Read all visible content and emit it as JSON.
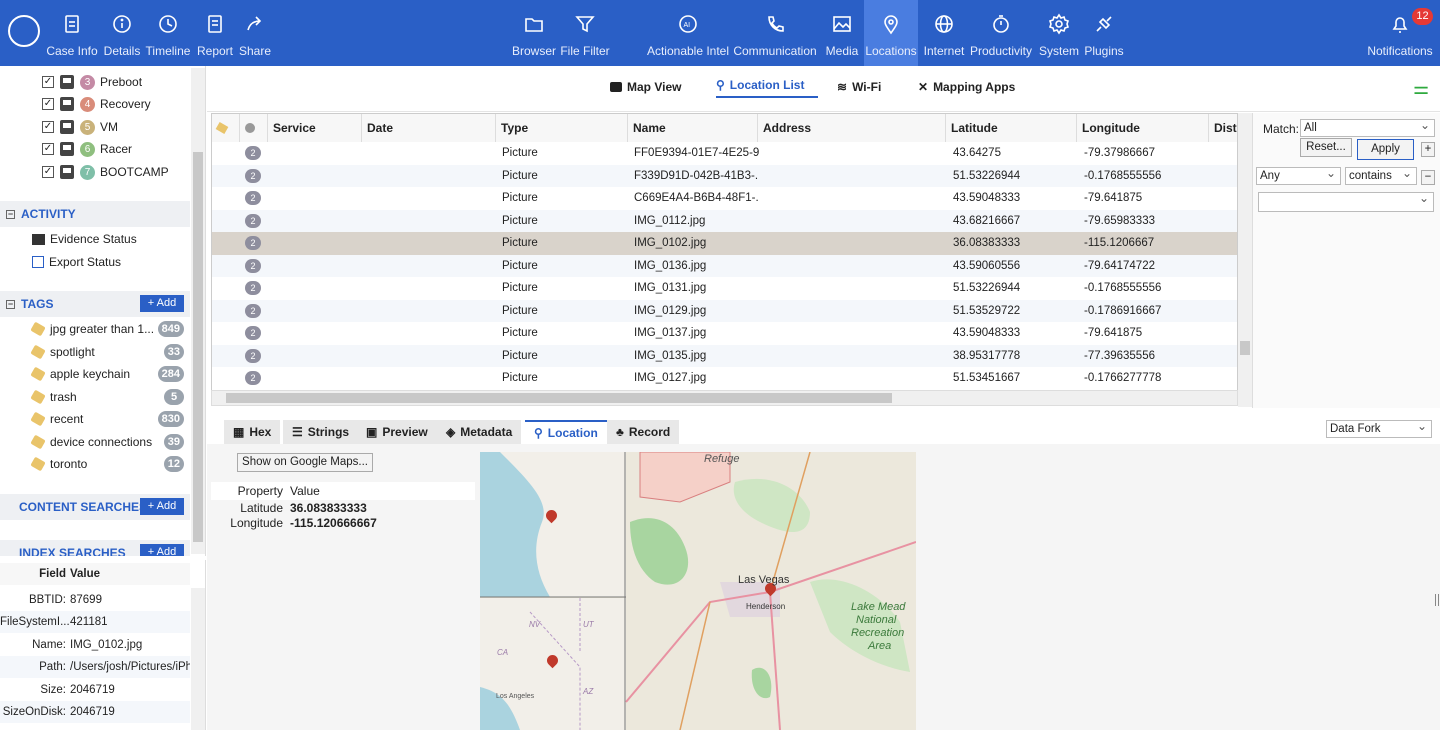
{
  "toolbar": {
    "left": [
      {
        "label": "Case Info",
        "icon": "case-info-icon"
      },
      {
        "label": "Details",
        "icon": "info-icon"
      },
      {
        "label": "Timeline",
        "icon": "timeline-icon"
      },
      {
        "label": "Report",
        "icon": "report-icon"
      },
      {
        "label": "Share",
        "icon": "share-icon"
      }
    ],
    "center": [
      {
        "label": "Browser",
        "icon": "folder-icon"
      },
      {
        "label": "File Filter",
        "icon": "filter-icon"
      },
      {
        "label": "Actionable Intel",
        "icon": "ai-icon"
      },
      {
        "label": "Communication",
        "icon": "phone-icon"
      },
      {
        "label": "Media",
        "icon": "image-icon"
      },
      {
        "label": "Locations",
        "icon": "map-pin-icon"
      },
      {
        "label": "Internet",
        "icon": "globe-icon"
      },
      {
        "label": "Productivity",
        "icon": "stopwatch-icon"
      },
      {
        "label": "System",
        "icon": "gear-icon"
      },
      {
        "label": "Plugins",
        "icon": "plug-icon"
      }
    ],
    "notifications": {
      "label": "Notifications",
      "count": "12"
    }
  },
  "sources": [
    {
      "num": "3",
      "label": "Preboot",
      "color": "#c48aa5"
    },
    {
      "num": "4",
      "label": "Recovery",
      "color": "#d98c7a"
    },
    {
      "num": "5",
      "label": "VM",
      "color": "#c9b27a"
    },
    {
      "num": "6",
      "label": "Racer",
      "color": "#8fbf7f"
    },
    {
      "num": "7",
      "label": "BOOTCAMP",
      "color": "#7fbfa8"
    }
  ],
  "activity": {
    "title": "ACTIVITY",
    "items": [
      "Evidence Status",
      "Export Status"
    ]
  },
  "tags": {
    "title": "TAGS",
    "add": "+ Add",
    "items": [
      {
        "label": "jpg greater than 1...",
        "count": "849"
      },
      {
        "label": "spotlight",
        "count": "33"
      },
      {
        "label": "apple keychain",
        "count": "284"
      },
      {
        "label": "trash",
        "count": "5"
      },
      {
        "label": "recent",
        "count": "830"
      },
      {
        "label": "device connections",
        "count": "39"
      },
      {
        "label": "toronto",
        "count": "12"
      }
    ]
  },
  "content_searches": {
    "title": "CONTENT SEARCHES",
    "add": "+ Add"
  },
  "index_searches": {
    "title": "INDEX SEARCHES",
    "add": "+ Add"
  },
  "fields": {
    "header": {
      "field": "Field",
      "value": "Value"
    },
    "rows": [
      {
        "k": "BBTID:",
        "v": "87699"
      },
      {
        "k": "FileSystemI...",
        "v": "421181"
      },
      {
        "k": "Name:",
        "v": "IMG_0102.jpg"
      },
      {
        "k": "Path:",
        "v": "/Users/josh/Pictures/iPh"
      },
      {
        "k": "Size:",
        "v": "2046719"
      },
      {
        "k": "SizeOnDisk:",
        "v": "2046719"
      }
    ]
  },
  "viewtabs": [
    "Map View",
    "Location List",
    "Wi-Fi",
    "Mapping Apps"
  ],
  "grid": {
    "headers": [
      "Service",
      "Date",
      "Type",
      "Name",
      "Address",
      "Latitude",
      "Longitude",
      "Dista"
    ],
    "rows": [
      {
        "n": "2",
        "type": "Picture",
        "name": "FF0E9394-01E7-4E25-9...",
        "lat": "43.64275",
        "lon": "-79.37986667"
      },
      {
        "n": "2",
        "type": "Picture",
        "name": "F339D91D-042B-41B3-...",
        "lat": "51.53226944",
        "lon": "-0.1768555556"
      },
      {
        "n": "2",
        "type": "Picture",
        "name": "C669E4A4-B6B4-48F1-...",
        "lat": "43.59048333",
        "lon": "-79.641875"
      },
      {
        "n": "2",
        "type": "Picture",
        "name": "IMG_0112.jpg",
        "lat": "43.68216667",
        "lon": "-79.65983333"
      },
      {
        "n": "2",
        "type": "Picture",
        "name": "IMG_0102.jpg",
        "lat": "36.08383333",
        "lon": "-115.1206667"
      },
      {
        "n": "2",
        "type": "Picture",
        "name": "IMG_0136.jpg",
        "lat": "43.59060556",
        "lon": "-79.64174722"
      },
      {
        "n": "2",
        "type": "Picture",
        "name": "IMG_0131.jpg",
        "lat": "51.53226944",
        "lon": "-0.1768555556"
      },
      {
        "n": "2",
        "type": "Picture",
        "name": "IMG_0129.jpg",
        "lat": "51.53529722",
        "lon": "-0.1786916667"
      },
      {
        "n": "2",
        "type": "Picture",
        "name": "IMG_0137.jpg",
        "lat": "43.59048333",
        "lon": "-79.641875"
      },
      {
        "n": "2",
        "type": "Picture",
        "name": "IMG_0135.jpg",
        "lat": "38.95317778",
        "lon": "-77.39635556"
      },
      {
        "n": "2",
        "type": "Picture",
        "name": "IMG_0127.jpg",
        "lat": "51.53451667",
        "lon": "-0.1766277778"
      }
    ]
  },
  "filter": {
    "match_label": "Match:",
    "match_value": "All",
    "reset": "Reset...",
    "apply": "Apply",
    "any": "Any",
    "contains": "contains"
  },
  "detail_tabs": [
    "Hex",
    "Strings",
    "Preview",
    "Metadata",
    "Location",
    "Record"
  ],
  "data_fork": "Data Fork",
  "location": {
    "show_btn": "Show on Google Maps...",
    "props": {
      "h1": "Property",
      "h2": "Value",
      "lat_k": "Latitude",
      "lat_v": "36.083833333",
      "lon_k": "Longitude",
      "lon_v": "-115.120666667"
    }
  },
  "map": {
    "labels": {
      "refuge": "Refuge",
      "lasvegas": "Las Vegas",
      "henderson": "Henderson",
      "lakemead": "Lake Mead",
      "national": "National",
      "recreation": "Recreation",
      "area": "Area",
      "nv": "NV",
      "ut": "UT",
      "ca": "CA",
      "az": "AZ",
      "losangeles": "Los Angeles"
    }
  }
}
